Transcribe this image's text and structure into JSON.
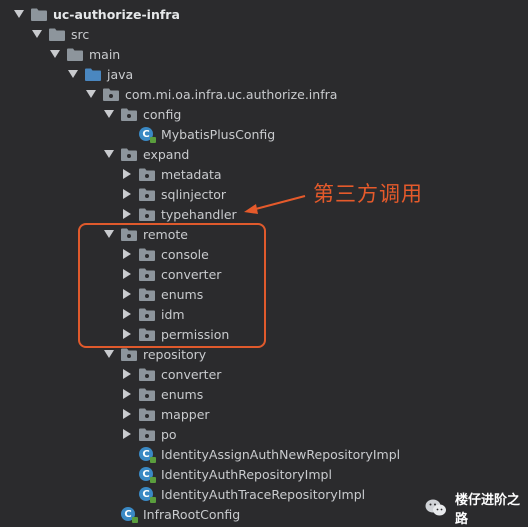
{
  "tree": [
    {
      "label": "uc-authorize-infra",
      "kind": "module",
      "state": "open",
      "depth": 0
    },
    {
      "label": "src",
      "kind": "folder",
      "state": "open",
      "depth": 1
    },
    {
      "label": "main",
      "kind": "folder",
      "state": "open",
      "depth": 2
    },
    {
      "label": "java",
      "kind": "source-folder",
      "state": "open",
      "depth": 3
    },
    {
      "label": "com.mi.oa.infra.uc.authorize.infra",
      "kind": "package",
      "state": "open",
      "depth": 4
    },
    {
      "label": "config",
      "kind": "package",
      "state": "open",
      "depth": 5
    },
    {
      "label": "MybatisPlusConfig",
      "kind": "class",
      "state": "leaf",
      "depth": 6
    },
    {
      "label": "expand",
      "kind": "package",
      "state": "open",
      "depth": 5
    },
    {
      "label": "metadata",
      "kind": "package",
      "state": "closed",
      "depth": 6
    },
    {
      "label": "sqlinjector",
      "kind": "package",
      "state": "closed",
      "depth": 6
    },
    {
      "label": "typehandler",
      "kind": "package",
      "state": "closed",
      "depth": 6
    },
    {
      "label": "remote",
      "kind": "package",
      "state": "open",
      "depth": 5
    },
    {
      "label": "console",
      "kind": "package",
      "state": "closed",
      "depth": 6
    },
    {
      "label": "converter",
      "kind": "package",
      "state": "closed",
      "depth": 6
    },
    {
      "label": "enums",
      "kind": "package",
      "state": "closed",
      "depth": 6
    },
    {
      "label": "idm",
      "kind": "package",
      "state": "closed",
      "depth": 6
    },
    {
      "label": "permission",
      "kind": "package",
      "state": "closed",
      "depth": 6
    },
    {
      "label": "repository",
      "kind": "package",
      "state": "open",
      "depth": 5
    },
    {
      "label": "converter",
      "kind": "package",
      "state": "closed",
      "depth": 6
    },
    {
      "label": "enums",
      "kind": "package",
      "state": "closed",
      "depth": 6
    },
    {
      "label": "mapper",
      "kind": "package",
      "state": "closed",
      "depth": 6
    },
    {
      "label": "po",
      "kind": "package",
      "state": "closed",
      "depth": 6
    },
    {
      "label": "IdentityAssignAuthNewRepositoryImpl",
      "kind": "class",
      "state": "leaf",
      "depth": 6
    },
    {
      "label": "IdentityAuthRepositoryImpl",
      "kind": "class",
      "state": "leaf",
      "depth": 6
    },
    {
      "label": "IdentityAuthTraceRepositoryImpl",
      "kind": "class",
      "state": "leaf",
      "depth": 6
    },
    {
      "label": "InfraRootConfig",
      "kind": "class",
      "state": "leaf",
      "depth": 5
    }
  ],
  "annotation": {
    "text": "第三方调用",
    "color": "#e55a2b"
  },
  "watermark": {
    "text": "楼仔进阶之路"
  },
  "colors": {
    "background": "#2b2b2d",
    "text": "#c9cbce",
    "folder": "#8d959c",
    "source_folder": "#4a87c0",
    "class_icon": "#3a89c4",
    "highlight": "#e05a2c"
  },
  "icons": {
    "expanded": "triangle-down-icon",
    "collapsed": "triangle-right-icon",
    "folder": "folder-icon",
    "package": "package-icon",
    "source_folder": "source-folder-icon",
    "class": "class-icon",
    "watermark": "wechat-icon"
  }
}
